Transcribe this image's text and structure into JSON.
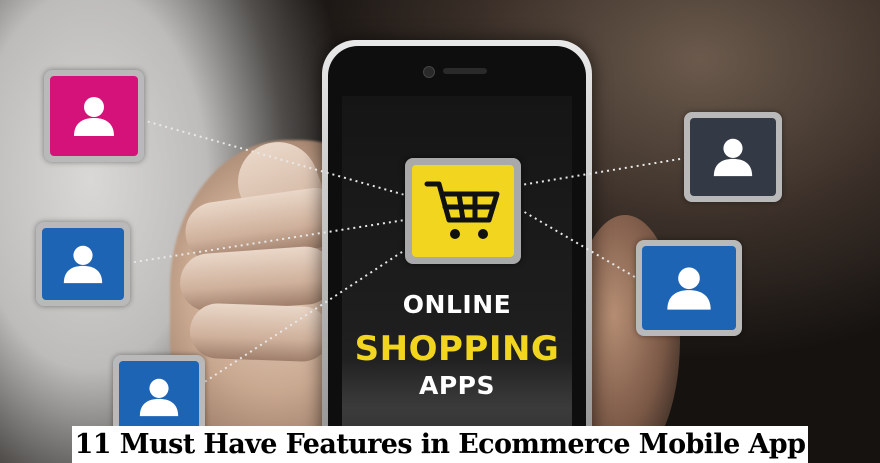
{
  "image": {
    "phone_screen": {
      "line1": "ONLINE",
      "line2": "SHOPPING",
      "line3": "APPS"
    },
    "caption": "11 Must Have Features in Ecommerce Mobile App",
    "colors": {
      "accent_yellow": "#f2d51f",
      "user_pink": "#d4127a",
      "user_blue": "#1e64b4",
      "user_dark": "#333a46"
    },
    "icons": {
      "center": "shopping-cart-icon",
      "nodes": [
        "user-icon",
        "user-icon",
        "user-icon",
        "user-icon",
        "user-icon"
      ]
    }
  }
}
